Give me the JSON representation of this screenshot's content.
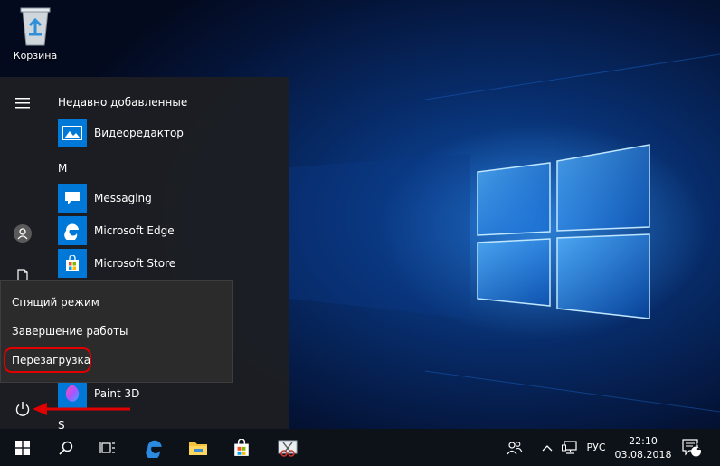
{
  "desktop": {
    "recycle_bin_label": "Корзина"
  },
  "start_menu": {
    "recent_header": "Недавно добавленные",
    "section_m": "M",
    "section_s": "S",
    "apps": {
      "video_editor": "Видеоредактор",
      "messaging": "Messaging",
      "edge": "Microsoft Edge",
      "store": "Microsoft Store",
      "paint3d": "Paint 3D"
    }
  },
  "power_menu": {
    "sleep": "Спящий режим",
    "shutdown": "Завершение работы",
    "restart": "Перезагрузка"
  },
  "taskbar": {
    "language": "РУС",
    "time": "22:10",
    "date": "03.08.2018",
    "notification_count": "2"
  },
  "colors": {
    "accent": "#0078d7",
    "highlight": "#e00000"
  }
}
